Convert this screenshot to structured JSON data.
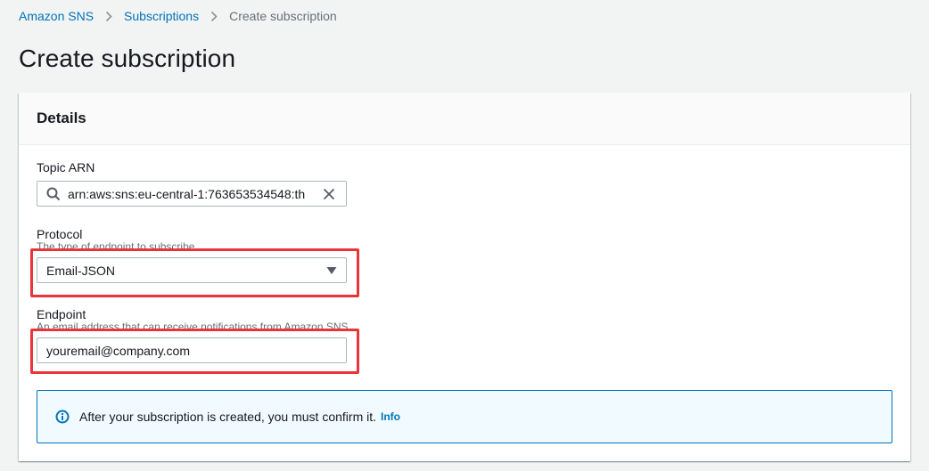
{
  "breadcrumb": {
    "items": [
      "Amazon SNS",
      "Subscriptions"
    ],
    "current": "Create subscription"
  },
  "page_title": "Create subscription",
  "details": {
    "title": "Details",
    "topic_arn": {
      "label": "Topic ARN",
      "value": "arn:aws:sns:eu-central-1:763653534548:th"
    },
    "protocol": {
      "label": "Protocol",
      "description": "The type of endpoint to subscribe",
      "selected": "Email-JSON"
    },
    "endpoint": {
      "label": "Endpoint",
      "description": "An email address that can receive notifications from Amazon SNS.",
      "value": "youremail@company.com"
    },
    "alert": {
      "text": "After your subscription is created, you must confirm it.",
      "link": "Info"
    }
  },
  "colors": {
    "link": "#0073bb",
    "highlight": "#e8343a",
    "alert_bg": "#f1faff"
  },
  "icons": {
    "search": "search-icon",
    "clear": "close-icon",
    "caret": "caret-down-icon",
    "info": "info-icon",
    "separator": "chevron-right-icon"
  }
}
